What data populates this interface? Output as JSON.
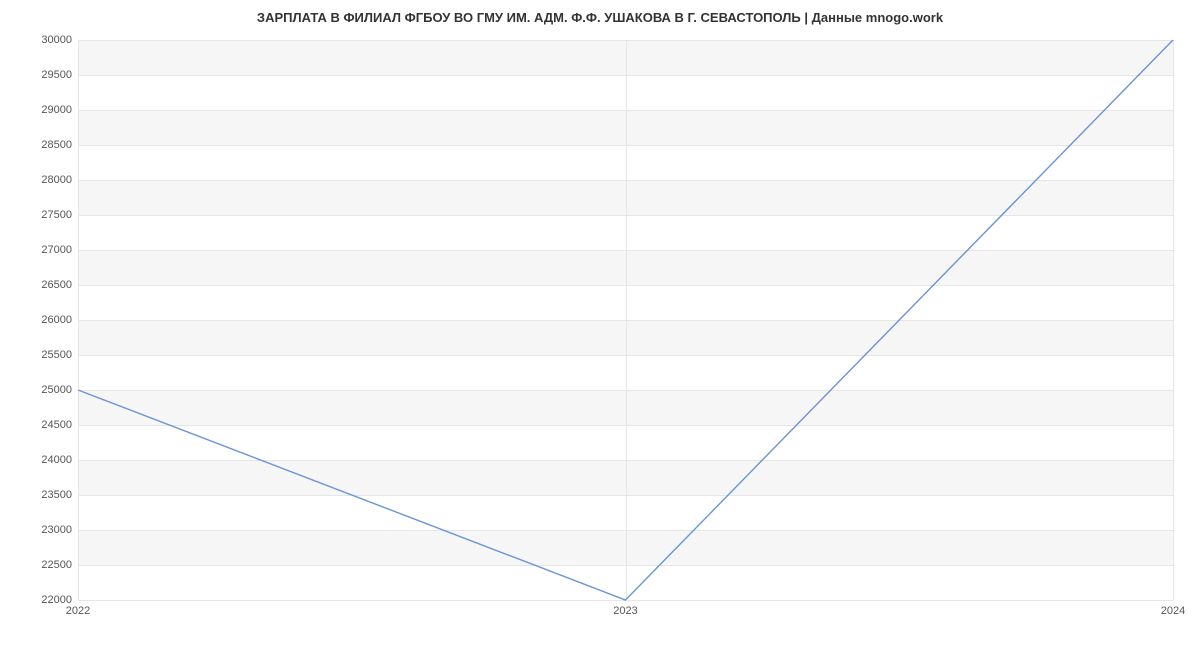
{
  "chart_data": {
    "type": "line",
    "title": "ЗАРПЛАТА В ФИЛИАЛ ФГБОУ ВО ГМУ ИМ. АДМ. Ф.Ф. УШАКОВА В Г. СЕВАСТОПОЛЬ | Данные mnogo.work",
    "x": [
      2022,
      2023,
      2024
    ],
    "values": [
      25000,
      22000,
      30000
    ],
    "xlabel": "",
    "ylabel": "",
    "ylim": [
      22000,
      30000
    ],
    "y_ticks": [
      22000,
      22500,
      23000,
      23500,
      24000,
      24500,
      25000,
      25500,
      26000,
      26500,
      27000,
      27500,
      28000,
      28500,
      29000,
      29500,
      30000
    ],
    "x_ticks": [
      2022,
      2023,
      2024
    ],
    "line_color": "#6b93d6"
  }
}
